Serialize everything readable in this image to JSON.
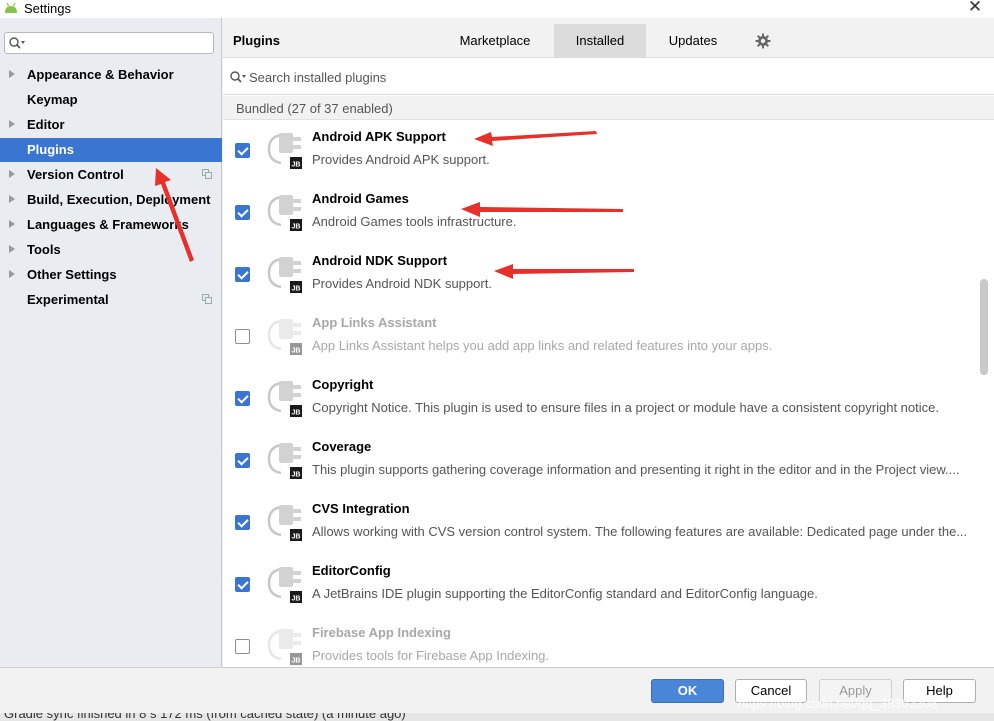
{
  "window": {
    "title": "Settings",
    "app_icon": "android-icon",
    "close_label": "✕"
  },
  "sidebar": {
    "search_value": "",
    "items": [
      {
        "label": "Appearance & Behavior",
        "expandable": true,
        "selected": false,
        "copy_icon": false
      },
      {
        "label": "Keymap",
        "expandable": false,
        "selected": false,
        "copy_icon": false
      },
      {
        "label": "Editor",
        "expandable": true,
        "selected": false,
        "copy_icon": false
      },
      {
        "label": "Plugins",
        "expandable": false,
        "selected": true,
        "copy_icon": false
      },
      {
        "label": "Version Control",
        "expandable": true,
        "selected": false,
        "copy_icon": true
      },
      {
        "label": "Build, Execution, Deployment",
        "expandable": true,
        "selected": false,
        "copy_icon": false
      },
      {
        "label": "Languages & Frameworks",
        "expandable": true,
        "selected": false,
        "copy_icon": false
      },
      {
        "label": "Tools",
        "expandable": true,
        "selected": false,
        "copy_icon": false
      },
      {
        "label": "Other Settings",
        "expandable": true,
        "selected": false,
        "copy_icon": false
      },
      {
        "label": "Experimental",
        "expandable": false,
        "selected": false,
        "copy_icon": true
      }
    ]
  },
  "main": {
    "heading": "Plugins",
    "tabs": [
      {
        "label": "Marketplace",
        "active": false
      },
      {
        "label": "Installed",
        "active": true
      },
      {
        "label": "Updates",
        "active": false
      }
    ],
    "gear_icon": "gear-icon",
    "search_placeholder": "Search installed plugins",
    "group_label": "Bundled (27 of 37 enabled)",
    "plugin_badge": "JB",
    "plugins": [
      {
        "name": "Android APK Support",
        "description": "Provides Android APK support.",
        "enabled": true
      },
      {
        "name": "Android Games",
        "description": "Android Games tools infrastructure.",
        "enabled": true
      },
      {
        "name": "Android NDK Support",
        "description": "Provides Android NDK support.",
        "enabled": true
      },
      {
        "name": "App Links Assistant",
        "description": "App Links Assistant helps you add app links and related features into your apps.",
        "enabled": false
      },
      {
        "name": "Copyright",
        "description": "Copyright Notice. This plugin is used to ensure files in a project or module have a consistent copyright notice.",
        "enabled": true
      },
      {
        "name": "Coverage",
        "description": "This plugin supports gathering coverage information and presenting it right in the editor and in the Project view....",
        "enabled": true
      },
      {
        "name": "CVS Integration",
        "description": "Allows working with CVS version control system. The following features are available: Dedicated page under the...",
        "enabled": true
      },
      {
        "name": "EditorConfig",
        "description": "A JetBrains IDE plugin supporting the EditorConfig standard and EditorConfig language.",
        "enabled": true
      },
      {
        "name": "Firebase App Indexing",
        "description": "Provides tools for Firebase App Indexing.",
        "enabled": false
      }
    ]
  },
  "buttons": {
    "ok": "OK",
    "cancel": "Cancel",
    "apply": "Apply",
    "help": "Help"
  },
  "status_text": "Gradle sync finished in 8 s 172 ms (from cached state) (a minute ago)",
  "watermark": "https://blog.csdn.net/qq_38303308",
  "colors": {
    "accent": "#3a75d1",
    "annotation": "#e8302a",
    "sidebar_bg": "#e9edf2"
  }
}
